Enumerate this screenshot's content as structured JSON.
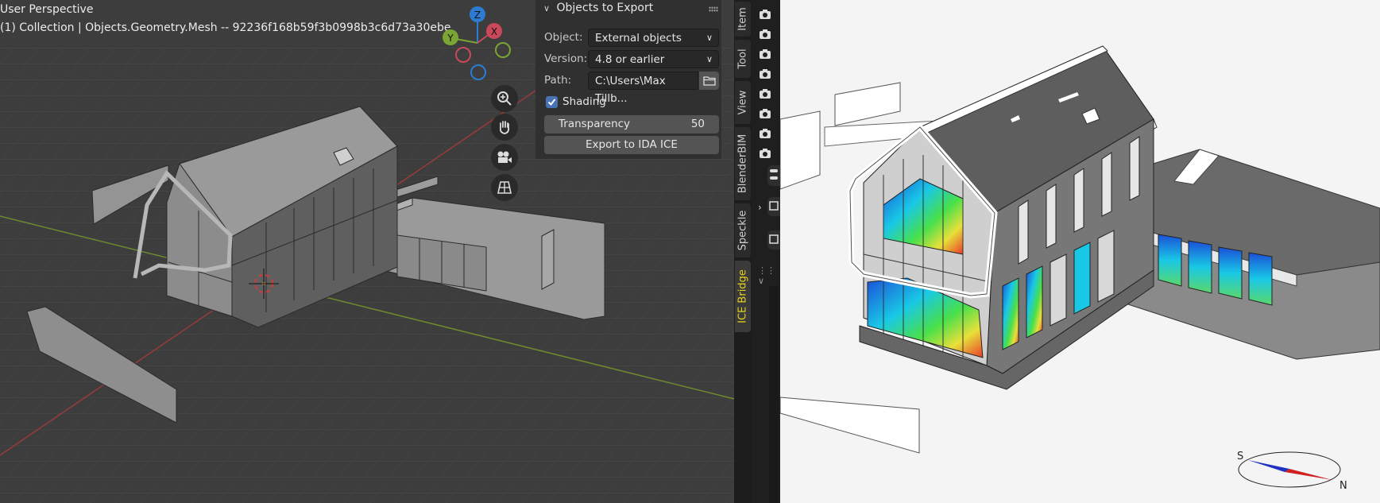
{
  "viewport": {
    "mode_label": "User Perspective",
    "collection_label": "(1) Collection | Objects.Geometry.Mesh -- 92236f168b59f3b0998b3c6d73a30ebe",
    "gizmo": {
      "z": "Z",
      "y": "Y",
      "x": "X"
    },
    "nav_buttons": [
      "zoom-icon",
      "hand-pan-icon",
      "camera-icon",
      "grid-ortho-icon"
    ]
  },
  "panel": {
    "title": "Objects to Export",
    "object_label": "Object:",
    "object_value": "External objects",
    "version_label": "Version:",
    "version_value": "4.8 or earlier",
    "path_label": "Path:",
    "path_value": "C:\\Users\\Max Tillb...",
    "shading_label": "Shading",
    "shading_checked": true,
    "transparency_label": "Transparency",
    "transparency_value": "50",
    "export_button": "Export to IDA ICE"
  },
  "sidebar_tabs": [
    "Item",
    "Tool",
    "View",
    "BlenderBIM",
    "Speckle",
    "ICE Bridge"
  ],
  "active_tab": "ICE Bridge",
  "render": {
    "compass": {
      "south": "S",
      "north": "N"
    }
  },
  "colors": {
    "active_tab": "#e5d21e",
    "accent_blue": "#4772b3",
    "axis_x": "#c9495a",
    "axis_y": "#7aa434",
    "axis_z": "#2c7cd2"
  }
}
